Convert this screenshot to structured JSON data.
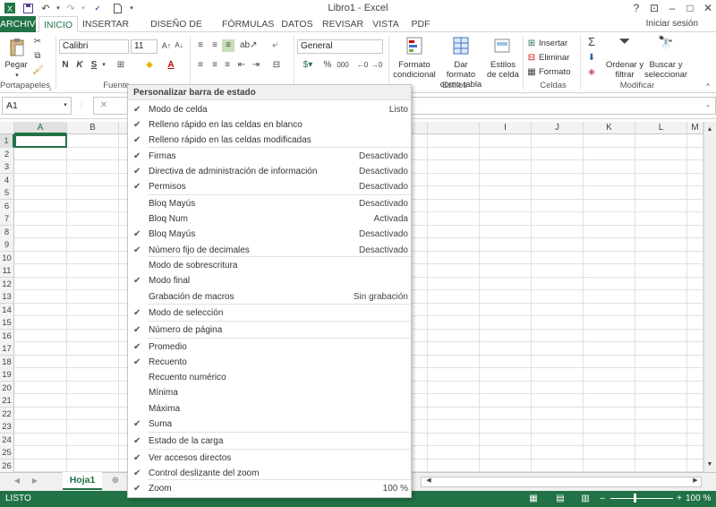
{
  "window": {
    "title": "Libro1 - Excel"
  },
  "ribbon_tabs": [
    "ARCHIVO",
    "INICIO",
    "INSERTAR",
    "DISEÑO DE PÁGINA",
    "FÓRMULAS",
    "DATOS",
    "REVISAR",
    "VISTA",
    "PDF"
  ],
  "sign_in": "Iniciar sesión",
  "ribbon": {
    "paste": "Pegar",
    "font_name": "Calibri",
    "font_size": "11",
    "number_format": "General",
    "conditional_format": "Formato condicional",
    "format_as_table": "Dar formato como tabla",
    "cell_styles": "Estilos de celda",
    "insert": "Insertar",
    "delete": "Eliminar",
    "format": "Formato",
    "sort_filter": "Ordenar y filtrar",
    "find_select": "Buscar y seleccionar",
    "groups": {
      "clipboard": "Portapapeles",
      "font": "Fuente",
      "styles": "Estilos",
      "cells": "Celdas",
      "modify": "Modificar"
    }
  },
  "name_box": "A1",
  "columns": [
    "A",
    "B",
    "",
    "",
    "",
    "",
    "",
    "",
    "",
    "I",
    "J",
    "K",
    "L",
    "M"
  ],
  "rows": [
    "1",
    "2",
    "3",
    "4",
    "5",
    "6",
    "7",
    "8",
    "9",
    "10",
    "11",
    "12",
    "13",
    "14",
    "15",
    "16",
    "17",
    "18",
    "19",
    "20",
    "21",
    "22",
    "23",
    "24",
    "25",
    "26"
  ],
  "sheet_tab": "Hoja1",
  "status": {
    "mode": "LISTO",
    "zoom": "100 %"
  },
  "menu": {
    "title": "Personalizar barra de estado",
    "items": [
      {
        "label": "Modo de celda",
        "value": "Listo",
        "checked": true
      },
      {
        "label": "Relleno rápido en las celdas en blanco",
        "value": "",
        "checked": true
      },
      {
        "label": "Relleno rápido en las celdas modificadas",
        "value": "",
        "checked": true
      },
      {
        "label": "Firmas",
        "value": "Desactivado",
        "checked": true
      },
      {
        "label": "Directiva de administración de información",
        "value": "Desactivado",
        "checked": true
      },
      {
        "label": "Permisos",
        "value": "Desactivado",
        "checked": true
      },
      {
        "label": "Bloq Mayús",
        "value": "Desactivado",
        "checked": false
      },
      {
        "label": "Bloq Num",
        "value": "Activada",
        "checked": false
      },
      {
        "label": "Bloq Mayús",
        "value": "Desactivado",
        "checked": true
      },
      {
        "label": "Número fijo de decimales",
        "value": "Desactivado",
        "checked": true
      },
      {
        "label": "Modo de sobrescritura",
        "value": "",
        "checked": false
      },
      {
        "label": "Modo final",
        "value": "",
        "checked": true
      },
      {
        "label": "Grabación de macros",
        "value": "Sin grabación",
        "checked": false
      },
      {
        "label": "Modo de selección",
        "value": "",
        "checked": true
      },
      {
        "label": "Número de página",
        "value": "",
        "checked": true
      },
      {
        "label": "Promedio",
        "value": "",
        "checked": true
      },
      {
        "label": "Recuento",
        "value": "",
        "checked": true
      },
      {
        "label": "Recuento numérico",
        "value": "",
        "checked": false
      },
      {
        "label": "Mínima",
        "value": "",
        "checked": false
      },
      {
        "label": "Máxima",
        "value": "",
        "checked": false
      },
      {
        "label": "Suma",
        "value": "",
        "checked": true
      },
      {
        "label": "Estado de la carga",
        "value": "",
        "checked": true
      },
      {
        "label": "Ver accesos directos",
        "value": "",
        "checked": true
      },
      {
        "label": "Control deslizante del zoom",
        "value": "",
        "checked": true
      },
      {
        "label": "Zoom",
        "value": "100 %",
        "checked": true
      }
    ]
  },
  "colors": {
    "excel_green": "#217346"
  }
}
